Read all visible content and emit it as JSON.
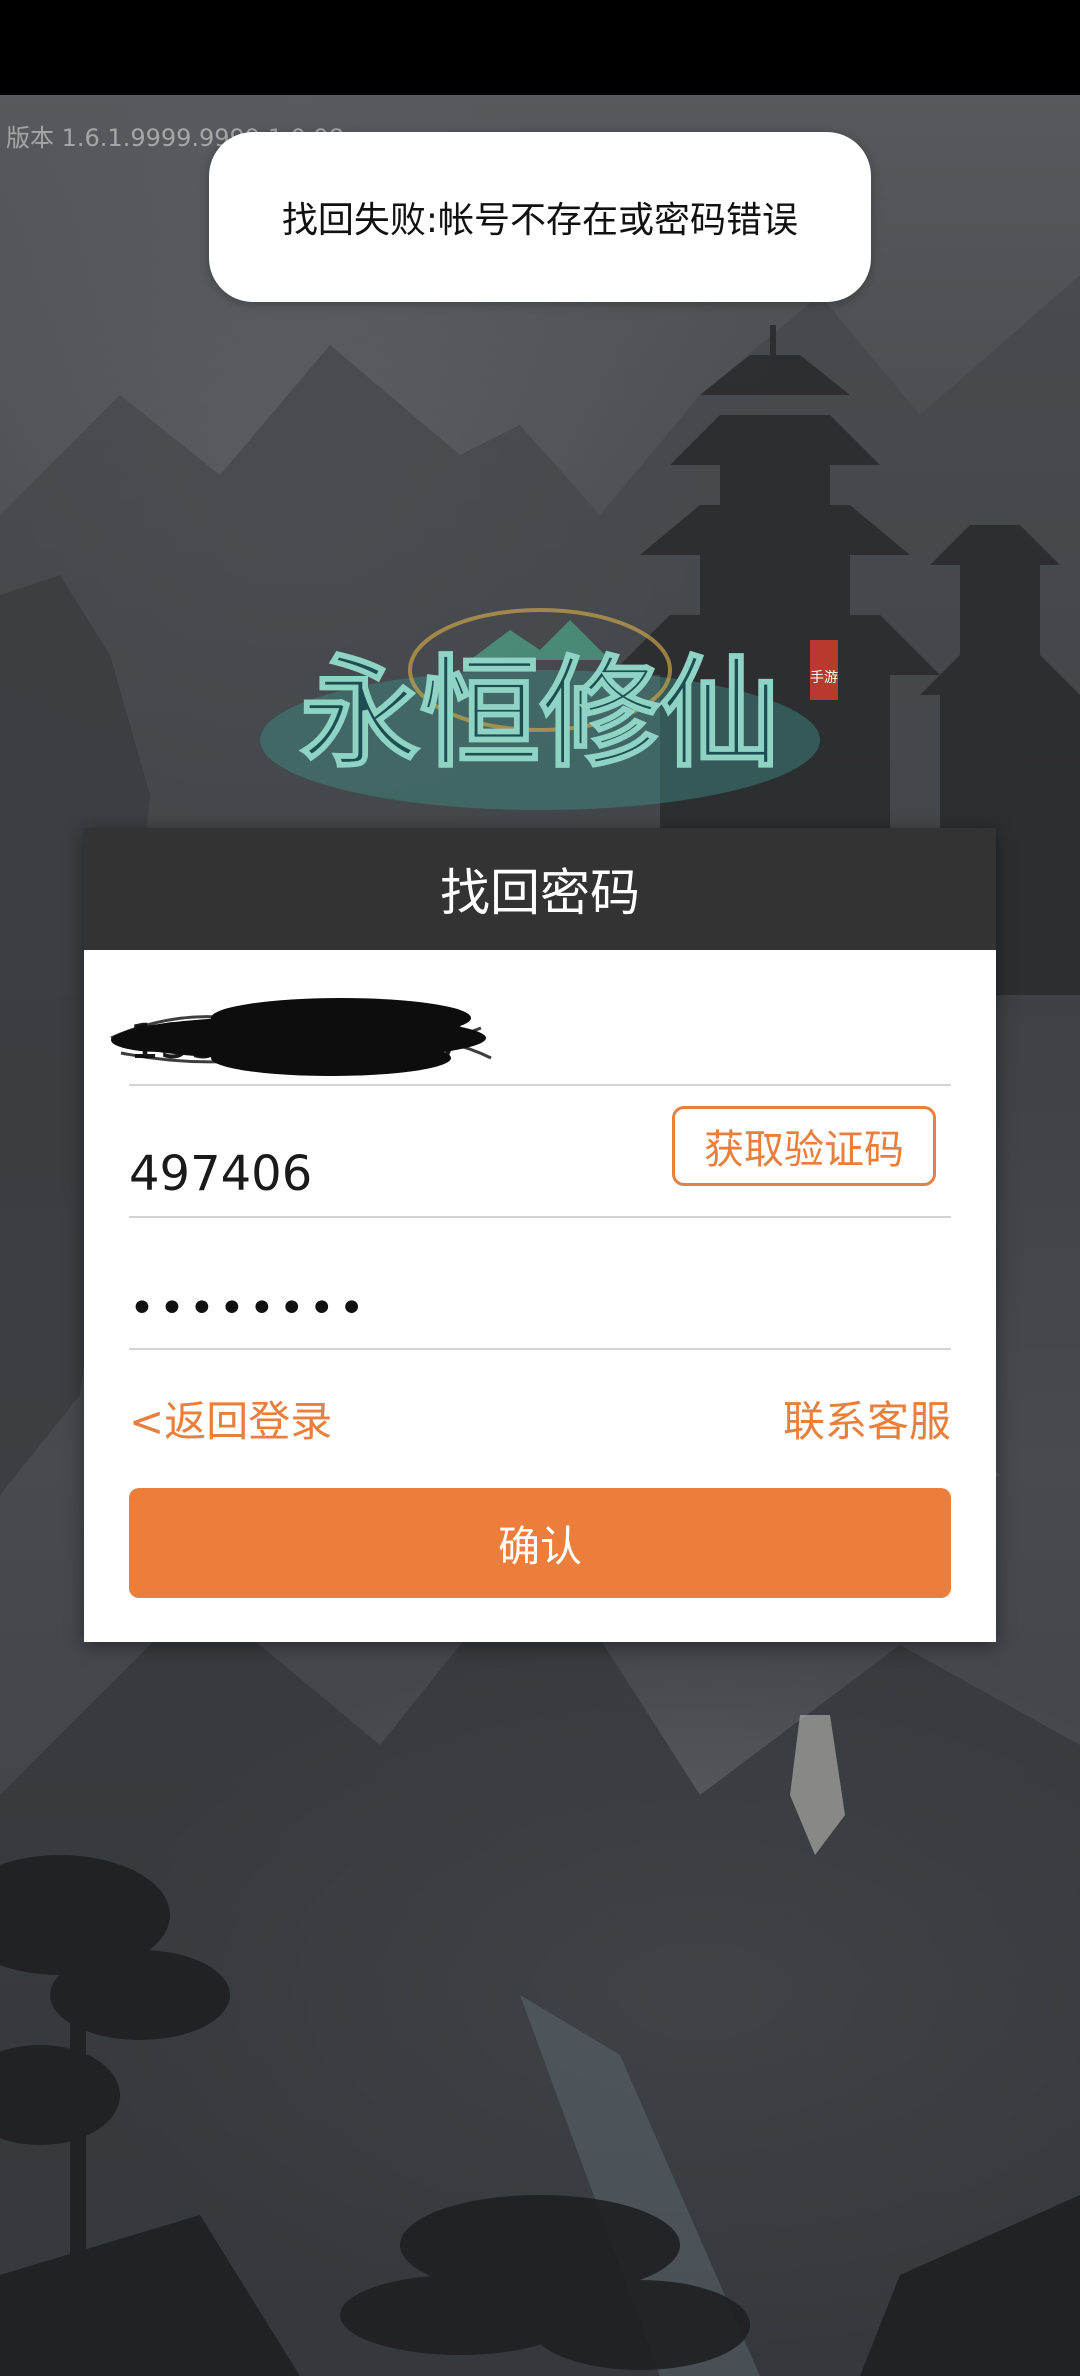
{
  "app": {
    "version_text": "版本  1.6.1.9999.9999.1.0.98",
    "logo_title": "永恒修仙",
    "logo_badge": "手游"
  },
  "toast": {
    "message": "找回失败:帐号不存在或密码错误"
  },
  "dialog": {
    "title": "找回密码",
    "phone_value": "13512345627",
    "code_value": "497406",
    "get_code_label": "获取验证码",
    "password_dots": "••••••••",
    "back_login_label": "<返回登录",
    "contact_service_label": "联系客服",
    "confirm_label": "确认"
  },
  "colors": {
    "accent": "#EC7D3A",
    "header": "#333333",
    "status_bar": "#000000"
  }
}
